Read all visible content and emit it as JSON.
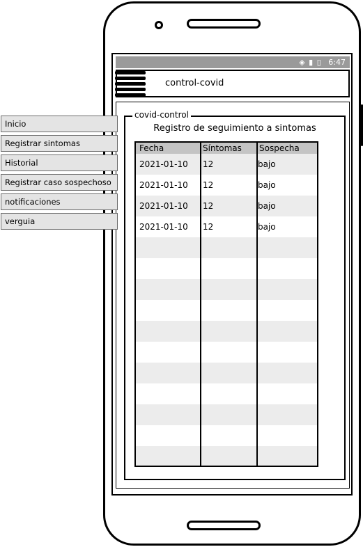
{
  "status_bar": {
    "icons": "wifi-icon signal-icon battery-icon",
    "time": "6:47"
  },
  "header": {
    "title": "control-covid"
  },
  "navigation": {
    "items": [
      {
        "label": "Inicio"
      },
      {
        "label": "Registrar sintomas"
      },
      {
        "label": "Historial"
      },
      {
        "label": "Registrar caso sospechoso"
      },
      {
        "label": "notificaciones"
      },
      {
        "label": "verguia"
      }
    ]
  },
  "panel": {
    "legend": "covid-control",
    "title": "Registro de seguimiento a sintomas"
  },
  "table": {
    "columns": [
      "Fecha",
      "Síntomas",
      "Sospecha"
    ],
    "rows": [
      [
        "2021-01-10",
        "12",
        "bajo"
      ],
      [
        "2021-01-10",
        "12",
        "bajo"
      ],
      [
        "2021-01-10",
        "12",
        "bajo"
      ],
      [
        "2021-01-10",
        "12",
        "bajo"
      ]
    ]
  },
  "colors": {
    "status_bar": "#9a9a9a",
    "table_header": "#c4c4c4",
    "alt_row": "#ececec",
    "nav_item": "#e4e4e4"
  }
}
